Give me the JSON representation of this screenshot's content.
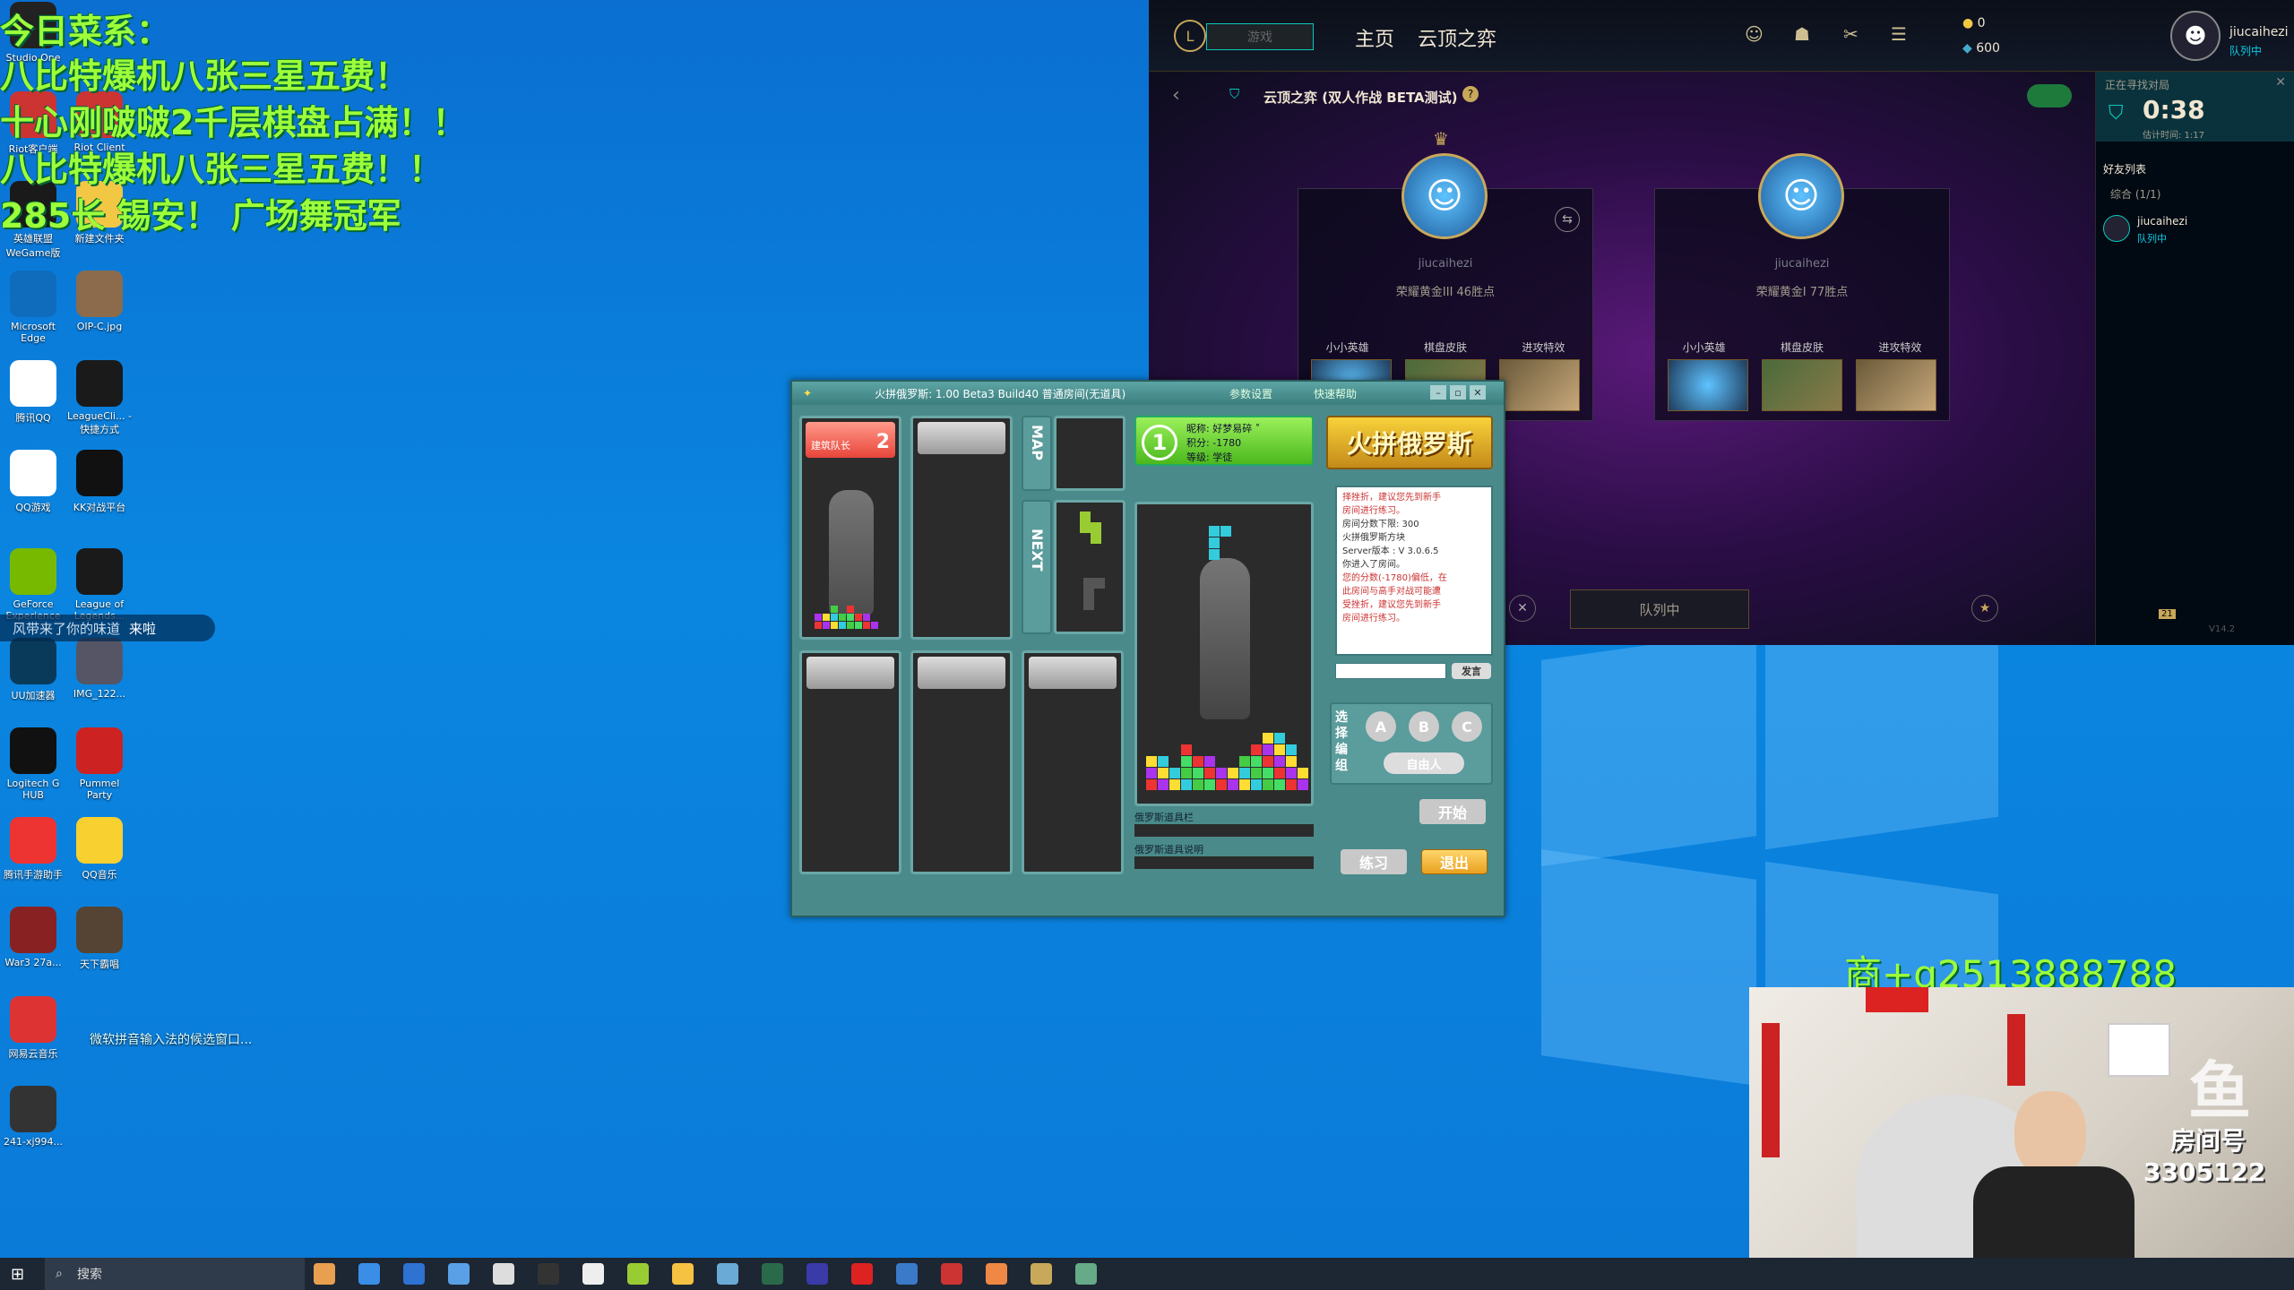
{
  "ticker": {
    "line1": "今日菜系：",
    "line2": "八比特爆机八张三星五费！",
    "line3": "十心刚啵啵2千层棋盘占满！！",
    "line4": "八比特爆机八张三星五费！！",
    "line5": "285长 锡安！ 广场舞冠军"
  },
  "chat_bubble": {
    "user": "风带来了你的味道",
    "msg": "来啦"
  },
  "desktop_icons": [
    {
      "label": "Studio One",
      "color": "#222"
    },
    {
      "label": "Riot客户端",
      "color": "#c33"
    },
    {
      "label": "Riot Client",
      "color": "#c33"
    },
    {
      "label": "英雄联盟 WeGame版",
      "color": "#1a1a1a"
    },
    {
      "label": "新建文件夹",
      "color": "#f2c744"
    },
    {
      "label": "Microsoft Edge",
      "color": "#0f6cbd"
    },
    {
      "label": "OIP-C.jpg",
      "color": "#8b6b4b"
    },
    {
      "label": "腾讯QQ",
      "color": "#fff"
    },
    {
      "label": "LeagueCli... - 快捷方式",
      "color": "#1a1a1a"
    },
    {
      "label": "QQ游戏",
      "color": "#fff"
    },
    {
      "label": "KK对战平台",
      "color": "#111"
    },
    {
      "label": "GeForce Experience",
      "color": "#76b900"
    },
    {
      "label": "League of Legends...",
      "color": "#1a1a1a"
    },
    {
      "label": "UU加速器",
      "color": "#0a3a5a"
    },
    {
      "label": "IMG_122...",
      "color": "#556"
    },
    {
      "label": "Logitech G HUB",
      "color": "#111"
    },
    {
      "label": "Pummel Party",
      "color": "#c22"
    },
    {
      "label": "腾讯手游助手",
      "color": "#e33"
    },
    {
      "label": "QQ音乐",
      "color": "#f8d030"
    },
    {
      "label": "War3 27a...",
      "color": "#822"
    },
    {
      "label": "天下霸唱",
      "color": "#543"
    },
    {
      "label": "网易云音乐",
      "color": "#d33"
    },
    {
      "label": "241-xj994...",
      "color": "#333"
    }
  ],
  "lol": {
    "play": "游戏",
    "nav_home": "主页",
    "nav_tft": "云顶之弈",
    "currency_rp": "0",
    "currency_be": "600",
    "username": "jiucaihezi",
    "status": "队列中",
    "mode_title": "云顶之弈 (双人作战 BETA测试)",
    "player1": {
      "name": "jiucaihezi",
      "rank": "荣耀黄金III 46胜点"
    },
    "player2": {
      "name": "jiucaihezi",
      "rank": "荣耀黄金I 77胜点"
    },
    "slot_labels": [
      "小小英雄",
      "棋盘皮肤",
      "进攻特效"
    ],
    "queue_btn": "队列中",
    "finding": "正在寻找对局",
    "timer": "0:38",
    "eta": "估计时间: 1:17",
    "friends": "好友列表",
    "group": "综合 (1/1)",
    "friend_name": "jiucaihezi",
    "friend_status": "队列中",
    "version": "V14.2",
    "badge": "21"
  },
  "game": {
    "title": "火拼俄罗斯: 1.00 Beta3 Build40   普通房间(无道具)",
    "btn_params": "参数设置",
    "btn_help": "快速帮助",
    "player_tag": "建筑队长",
    "player_num": "2",
    "map": "MAP",
    "next": "NEXT",
    "info_num": "1",
    "info_nick": "昵称: 好梦易碎 ˚",
    "info_score": "积分: -1780",
    "info_level": "等级: 学徒",
    "logo": "火拼俄罗斯",
    "chat_lines": [
      "择挫折，建议您先到新手",
      "房间进行练习。",
      "房间分数下限: 300",
      "火拼俄罗斯方块",
      "Server版本 : V 3.0.6.5",
      "你进入了房间。",
      "您的分数(-1780)偏低，在",
      "此房间与高手对战可能遭",
      "受挫折，建议您先到新手",
      "房间进行练习。"
    ],
    "send": "发言",
    "team_label": "选择编组",
    "team_a": "A",
    "team_b": "B",
    "team_c": "C",
    "free": "自由人",
    "start": "开始",
    "tools_bar": "俄罗斯道具栏",
    "tools_desc": "俄罗斯道具说明",
    "practice": "练习",
    "exit": "退出"
  },
  "taskbar": {
    "search": "搜索"
  },
  "promo": "商+q2513888788",
  "room": {
    "label": "房间号",
    "number": "3305122"
  },
  "desktop_note": "微软拼音输入法的候选窗口..."
}
